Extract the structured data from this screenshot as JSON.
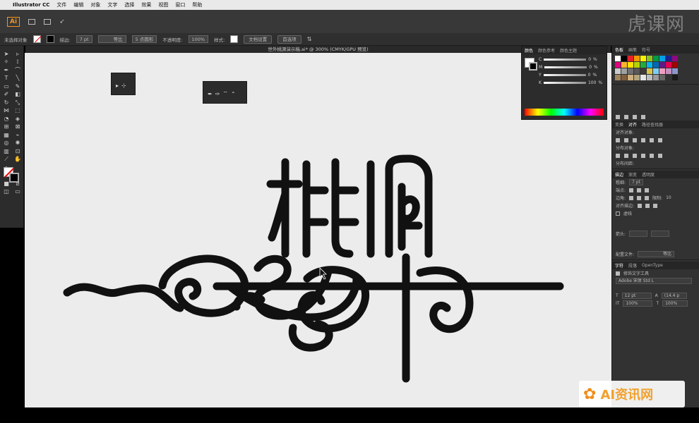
{
  "menubar": {
    "apple": "",
    "app_name": "Illustrator CC",
    "items": [
      "文件",
      "编辑",
      "对象",
      "文字",
      "选择",
      "效果",
      "视图",
      "窗口",
      "帮助"
    ]
  },
  "brand": {
    "logo": "Ai",
    "watermark": "虎课网"
  },
  "control_bar": {
    "selection_label": "未选择对象",
    "stroke_label": "描边:",
    "stroke_value": "7 pt",
    "profile_label": "等比",
    "brush_label": "5 点圆形",
    "opacity_label": "不透明度:",
    "opacity_value": "100%",
    "style_label": "样式:",
    "doc_setup_btn": "文档设置",
    "prefs_btn": "首选项"
  },
  "document": {
    "tab_title": "世外桃源演示稿.ai* @ 300% (CMYK/GPU 预览)"
  },
  "color_panel": {
    "tabs": [
      "颜色",
      "颜色参考",
      "颜色主题"
    ],
    "channels": [
      {
        "label": "C",
        "value": "0",
        "unit": "%"
      },
      {
        "label": "M",
        "value": "0",
        "unit": "%"
      },
      {
        "label": "Y",
        "value": "0",
        "unit": "%"
      },
      {
        "label": "K",
        "value": "100",
        "unit": "%"
      }
    ]
  },
  "swatches_panel": {
    "tabs": [
      "色板",
      "画笔",
      "符号"
    ],
    "colors": [
      "#ffffff",
      "#000000",
      "#e62129",
      "#f39800",
      "#fff100",
      "#8fc31f",
      "#009944",
      "#00a0e9",
      "#1d2088",
      "#920783",
      "#e4007f",
      "#f7b52c",
      "#ffe100",
      "#b8d200",
      "#22ac38",
      "#00b7ee",
      "#0068b7",
      "#601986",
      "#e5004f",
      "#a40000",
      "#c9caca",
      "#9fa0a0",
      "#727171",
      "#595757",
      "#3e3a39",
      "#d7c447",
      "#7ecef4",
      "#f19ec2",
      "#c490bf",
      "#8c97cb",
      "#a2855d",
      "#7f5f3d",
      "#d0b07e",
      "#b3a47e",
      "#e6e6e6",
      "#bfbfbf",
      "#999999",
      "#666666",
      "#333333",
      "#1a1a1a"
    ]
  },
  "align_panel": {
    "tabs": [
      "变换",
      "对齐",
      "路径查找器"
    ],
    "align_objects": "对齐对象:",
    "distribute_objects": "分布对象:",
    "distribute_spacing": "分布间距:"
  },
  "stroke_panel": {
    "tabs": [
      "描边",
      "渐变",
      "透明度"
    ],
    "weight_label": "粗细:",
    "weight_value": "7 pt",
    "cap_label": "端点:",
    "corner_label": "边角:",
    "limit_label": "限制:",
    "limit_value": "10",
    "align_label": "对齐描边:",
    "dashed_label": "虚线",
    "arrow_label": "箭头:",
    "profile_label": "配置文件:",
    "profile_value": "等比"
  },
  "character_panel": {
    "tabs": [
      "字符",
      "段落",
      "OpenType"
    ],
    "touch_type": "修饰文字工具",
    "font_family": "Adobe 宋体 Std L",
    "size_value": "12 pt",
    "leading_value": "(14.4 p",
    "h_scale": "100%",
    "v_scale": "100%"
  },
  "artwork": {
    "glyphs": "桃源"
  },
  "ai_badge": {
    "text": "AI资讯网"
  },
  "float_panels": {
    "panel1_icons": [
      "direct-select-icon",
      "group-select-icon"
    ],
    "panel2_icons": [
      "anchor-add-icon",
      "anchor-delete-icon",
      "anchor-convert-icon",
      "curvature-icon"
    ]
  }
}
